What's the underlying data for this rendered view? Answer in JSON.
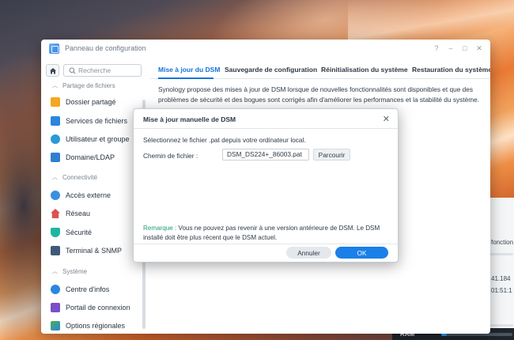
{
  "window": {
    "title": "Panneau de configuration",
    "controls": [
      "?",
      "–",
      "□",
      "✕"
    ]
  },
  "sidebar": {
    "search_placeholder": "Recherche",
    "sections": [
      {
        "title": "Partage de fichiers",
        "items": [
          {
            "label": "Dossier partagé",
            "icon": "folder-icon"
          },
          {
            "label": "Services de fichiers",
            "icon": "file-services-icon"
          },
          {
            "label": "Utilisateur et groupe",
            "icon": "users-icon"
          },
          {
            "label": "Domaine/LDAP",
            "icon": "domain-icon"
          }
        ]
      },
      {
        "title": "Connectivité",
        "items": [
          {
            "label": "Accès externe",
            "icon": "globe-icon"
          },
          {
            "label": "Réseau",
            "icon": "network-icon"
          },
          {
            "label": "Sécurité",
            "icon": "shield-icon"
          },
          {
            "label": "Terminal & SNMP",
            "icon": "terminal-icon"
          }
        ]
      },
      {
        "title": "Système",
        "items": [
          {
            "label": "Centre d'infos",
            "icon": "info-icon"
          },
          {
            "label": "Portail de connexion",
            "icon": "portal-icon"
          },
          {
            "label": "Options régionales",
            "icon": "regional-icon"
          }
        ]
      }
    ]
  },
  "tabs": [
    {
      "label": "Mise à jour du DSM",
      "active": true
    },
    {
      "label": "Sauvegarde de configuration",
      "active": false
    },
    {
      "label": "Réinitialisation du système",
      "active": false
    },
    {
      "label": "Restauration du système",
      "active": false
    }
  ],
  "content": {
    "description": "Synology propose des mises à jour de DSM lorsque de nouvelles fonctionnalités sont disponibles et que des problèmes de sécurité et des bogues sont corrigés afin d'améliorer les performances et la stabilité du système."
  },
  "dialog": {
    "title": "Mise à jour manuelle de DSM",
    "close": "✕",
    "instruction": "Sélectionnez le fichier .pat depuis votre ordinateur local.",
    "file_path_label": "Chemin de fichier :",
    "file_path_value": "DSM_DS224+_86003.pat",
    "browse_label": "Parcourir",
    "note_label": "Remarque :",
    "note_text": " Vous ne pouvez pas revenir à une version antérieure de DSM. Le DSM installé doit être plus récent que le DSM actuel.",
    "cancel_label": "Annuler",
    "ok_label": "OK"
  },
  "background_widget": {
    "line1": "fonction",
    "line2": "41.184",
    "line3": "01:51:1",
    "ram_label": "RAM"
  },
  "colors": {
    "accent": "#1673d6",
    "ok_button": "#1b7fe8",
    "note_label": "#1e9c7a"
  }
}
